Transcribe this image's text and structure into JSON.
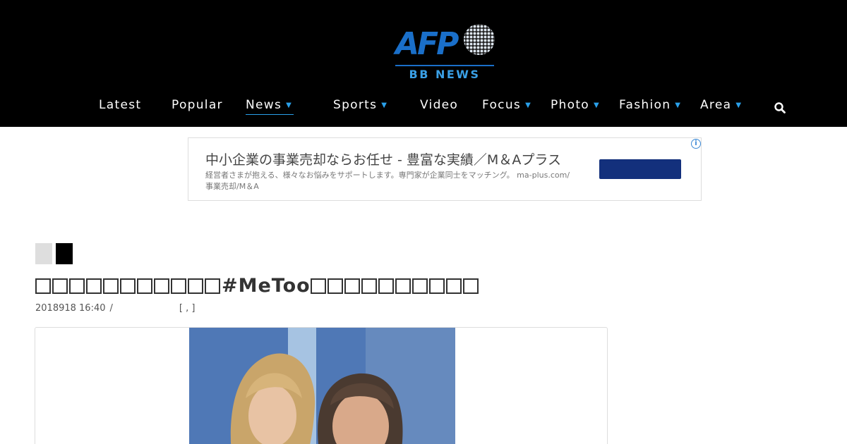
{
  "brand": {
    "logo_text": "AFP",
    "logo_sub": "BB NEWS",
    "accent_color": "#1a6fc9",
    "nav_accent_color": "#2aa0ea"
  },
  "nav": {
    "items": [
      {
        "label": "Latest",
        "has_dropdown": false
      },
      {
        "label": "Popular",
        "has_dropdown": false
      },
      {
        "label": "News",
        "has_dropdown": true,
        "active": true
      },
      {
        "label": "Sports",
        "has_dropdown": true
      },
      {
        "label": "Video",
        "has_dropdown": false
      },
      {
        "label": "Focus",
        "has_dropdown": true
      },
      {
        "label": "Photo",
        "has_dropdown": true
      },
      {
        "label": "Fashion",
        "has_dropdown": true
      },
      {
        "label": "Area",
        "has_dropdown": true
      }
    ],
    "dropdown_glyph": "▼",
    "search_icon": "search-icon"
  },
  "ad": {
    "title": "中小企業の事業売却ならお任せ - 豊富な実績／M＆Aプラス",
    "description": "経営者さまが抱える、様々なお悩みをサポートします。専門家が企業同士をマッチング。 ma-plus.com/事業売却/M＆A",
    "info_glyph": "i",
    "button_color": "#13307c"
  },
  "article": {
    "headline_pre_boxes": 11,
    "headline_mid": "#MeToo",
    "headline_post_boxes": 10,
    "date": "2018918 16:40",
    "separator": "/",
    "bracket_text": "[ , ]"
  }
}
